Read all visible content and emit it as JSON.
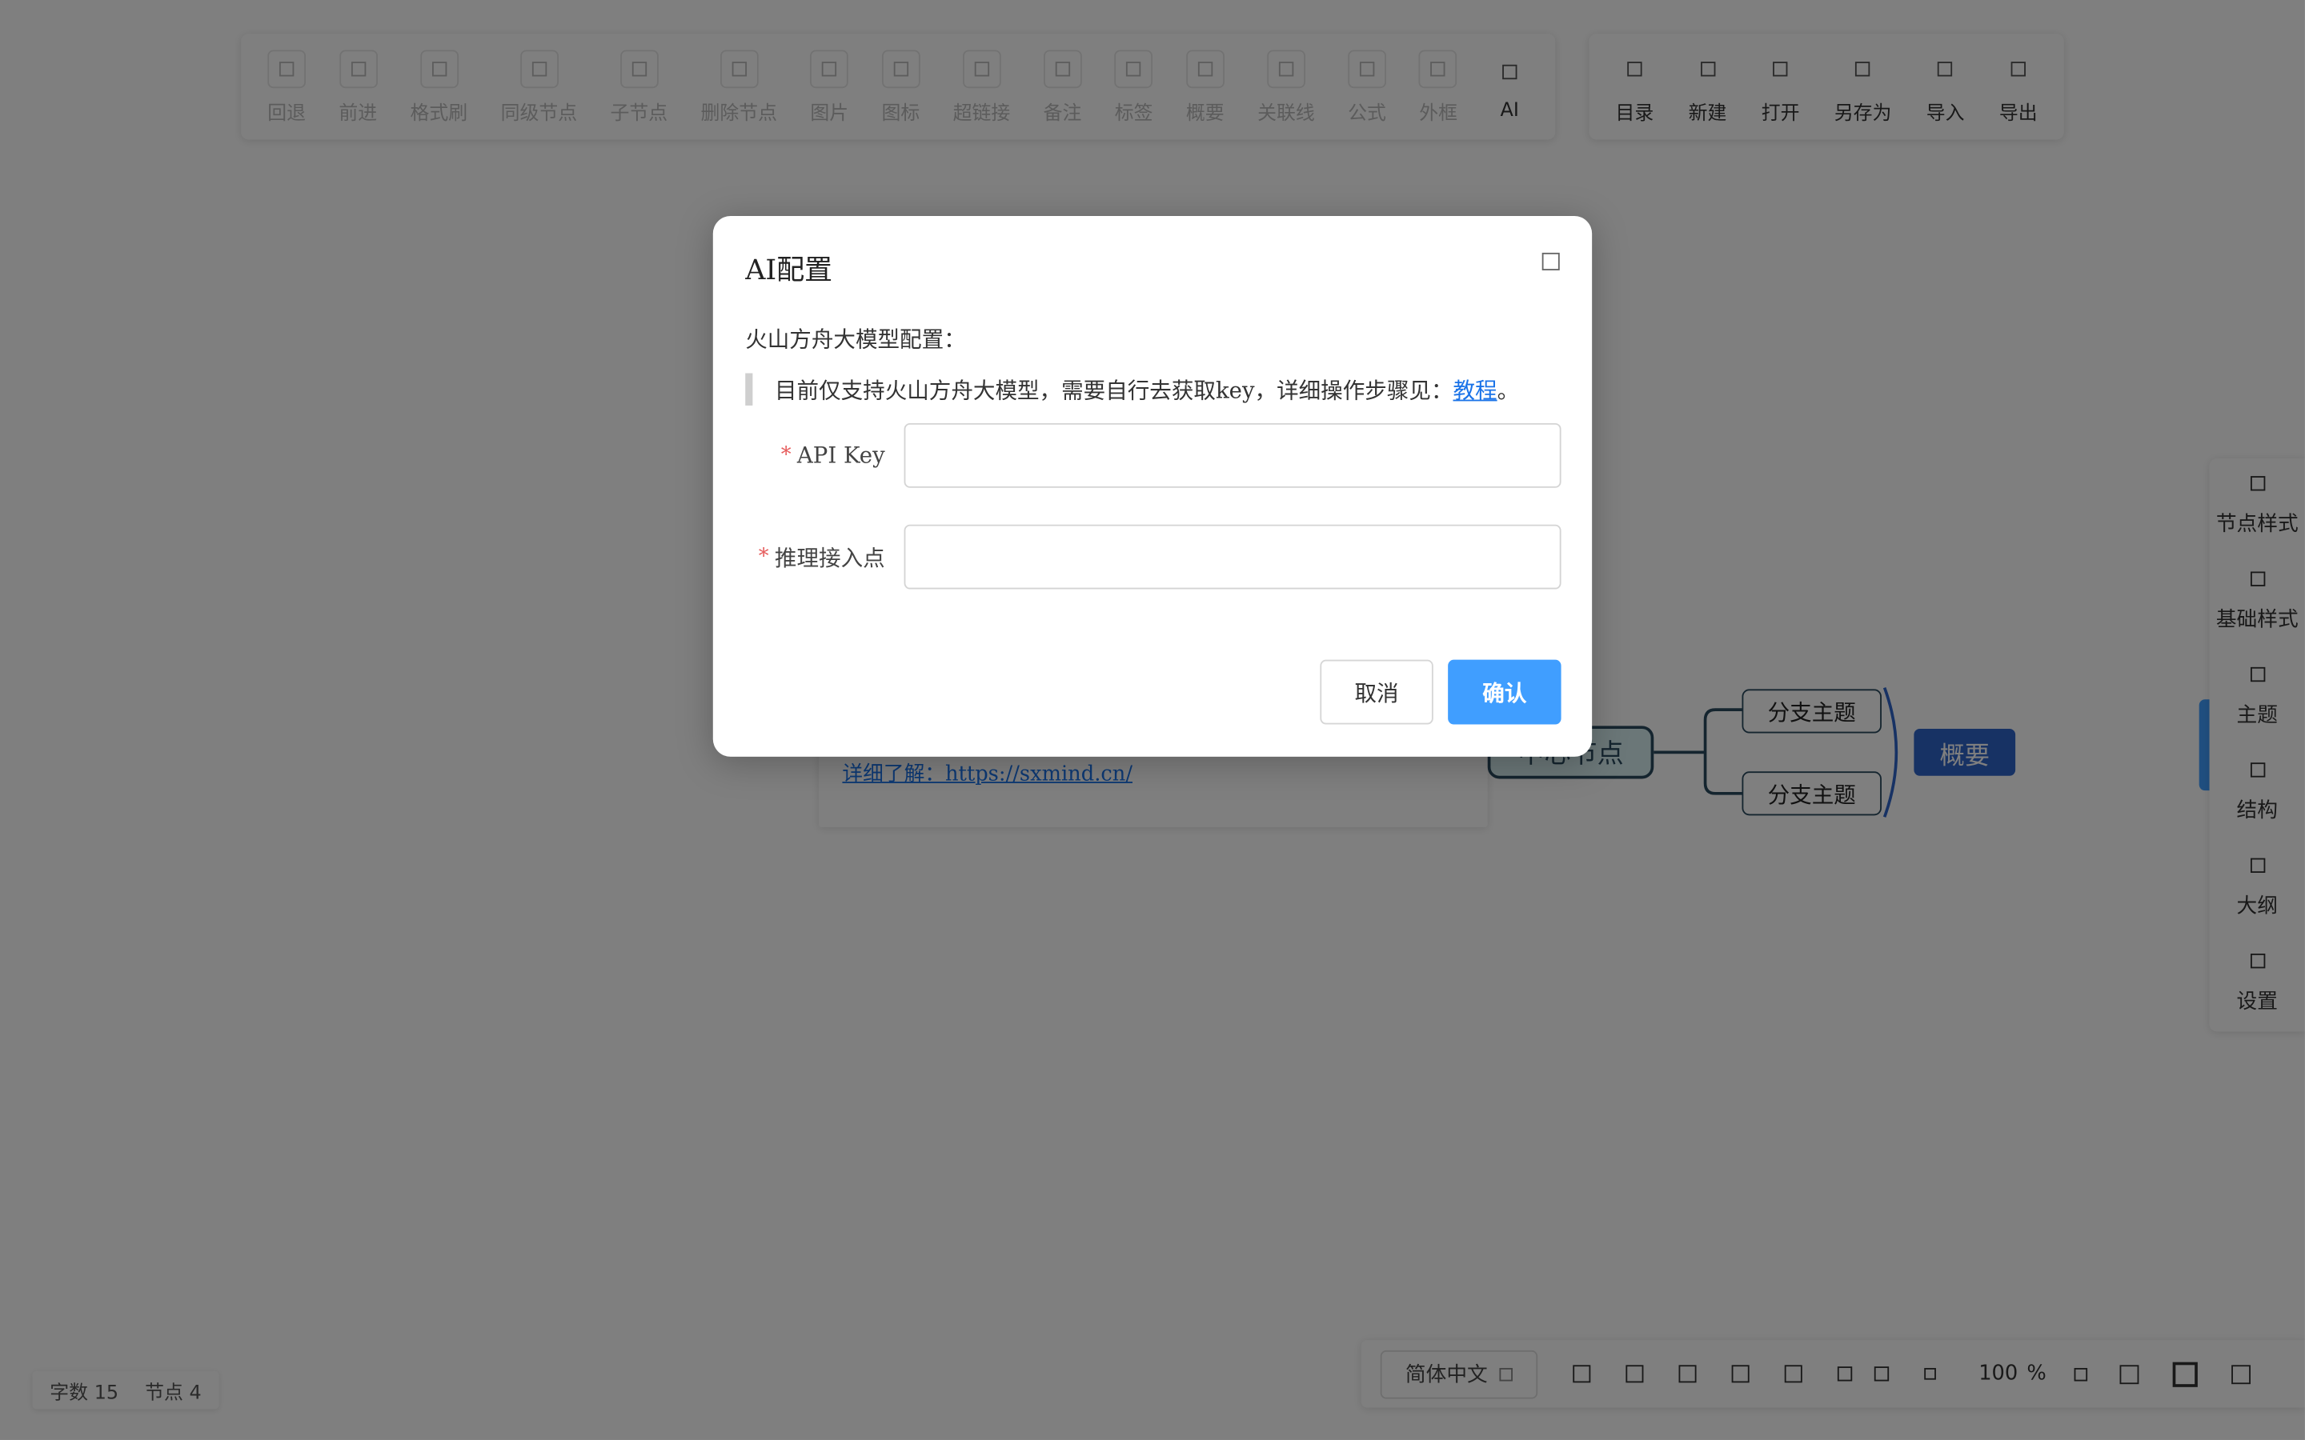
{
  "toolbar_left": [
    {
      "label": "回退",
      "disabled": true
    },
    {
      "label": "前进",
      "disabled": true
    },
    {
      "label": "格式刷",
      "disabled": true
    },
    {
      "label": "同级节点",
      "disabled": true
    },
    {
      "label": "子节点",
      "disabled": true
    },
    {
      "label": "删除节点",
      "disabled": true
    },
    {
      "label": "图片",
      "disabled": true
    },
    {
      "label": "图标",
      "disabled": true
    },
    {
      "label": "超链接",
      "disabled": true
    },
    {
      "label": "备注",
      "disabled": true
    },
    {
      "label": "标签",
      "disabled": true
    },
    {
      "label": "概要",
      "disabled": true
    },
    {
      "label": "关联线",
      "disabled": true
    },
    {
      "label": "公式",
      "disabled": true
    },
    {
      "label": "外框",
      "disabled": true
    },
    {
      "label": "AI",
      "disabled": false
    }
  ],
  "toolbar_right": [
    {
      "label": "目录"
    },
    {
      "label": "新建"
    },
    {
      "label": "打开"
    },
    {
      "label": "另存为"
    },
    {
      "label": "导入"
    },
    {
      "label": "导出"
    }
  ],
  "canvas": {
    "note_link": "详细了解：https://sxmind.cn/",
    "root_node": "中心节点",
    "branch_nodes": [
      "分支主题",
      "分支主题"
    ],
    "summary_node": "概要"
  },
  "right_panel": [
    "节点样式",
    "基础样式",
    "主题",
    "结构",
    "大纲",
    "设置"
  ],
  "status": {
    "word_count_label": "字数",
    "word_count": "15",
    "node_count_label": "节点",
    "node_count": "4"
  },
  "bottom_bar": {
    "language": "简体中文",
    "zoom_value": "100",
    "zoom_unit": "%"
  },
  "modal": {
    "title": "AI配置",
    "section_title": "火山方舟大模型配置：",
    "notice_text": "目前仅支持火山方舟大模型，需要自行去获取key，详细操作步骤见：",
    "notice_link": "教程",
    "notice_suffix": "。",
    "fields": [
      {
        "label": "API Key",
        "value": ""
      },
      {
        "label": "推理接入点",
        "value": ""
      }
    ],
    "cancel_label": "取消",
    "confirm_label": "确认"
  },
  "colors": {
    "primary": "#409eff",
    "summary_node": "#2f64c9",
    "required_mark": "#e65c5c",
    "link": "#1a73e8"
  }
}
